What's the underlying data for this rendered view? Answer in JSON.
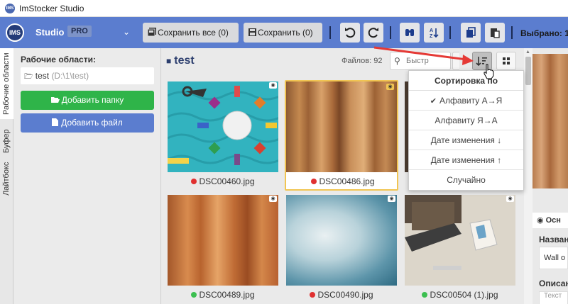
{
  "window": {
    "title": "ImStocker Studio",
    "app_icon_text": "IMS"
  },
  "toolbar": {
    "logo_text": "IMS",
    "brand": "Studio",
    "pro_badge": "PRO",
    "save_all": "Сохранить все (0)",
    "save": "Сохранить (0)",
    "selected": "Выбрано: 1"
  },
  "vtabs": [
    "Рабочие области",
    "Буфер",
    "Лайтбокс"
  ],
  "left_panel": {
    "title": "Рабочие области:",
    "workspace_name": "test",
    "workspace_path": "(D:\\1\\test)",
    "add_folder": "Добавить папку",
    "add_file": "Добавить файл"
  },
  "center": {
    "folder_title": "test",
    "files_count": "Файлов: 92",
    "search_placeholder": "Быстр"
  },
  "thumbnails": [
    {
      "name": "DSC00460.jpg",
      "status_color": "#e03030"
    },
    {
      "name": "DSC00486.jpg",
      "status_color": "#e03030"
    },
    {
      "name": "DSC00489.jpg",
      "status_color": "#3cbf50"
    },
    {
      "name": "DSC00490.jpg",
      "status_color": "#e03030"
    },
    {
      "name": "DSC00504 (1).jpg",
      "status_color": "#3cbf50"
    }
  ],
  "sort_menu": {
    "title": "Сортировка по",
    "items": [
      "Алфавиту А→Я",
      "Алфавиту Я→А",
      "Дате изменения ↓",
      "Дате изменения ↑",
      "Случайно"
    ]
  },
  "right_panel": {
    "tab": "Осн",
    "label_name": "Назван",
    "name_value": "Wall o",
    "label_desc": "Описан",
    "desc_value": "Текст"
  },
  "colors": {
    "toolbar": "#5b7dcf",
    "green": "#2fb449",
    "arrow": "#e53935"
  }
}
